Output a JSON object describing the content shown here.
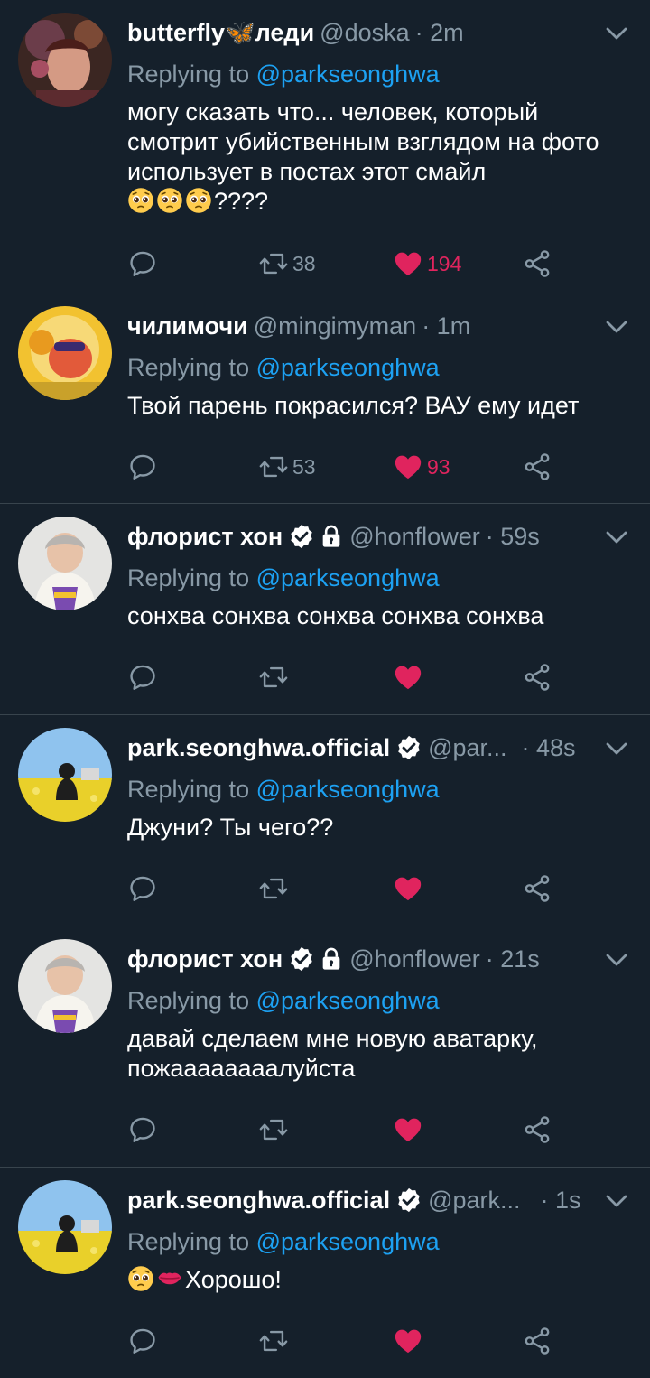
{
  "tweets": [
    {
      "name": "butterfly🦋леди",
      "handle": "@doska",
      "time": "· 2m",
      "reply_prefix": "Replying to ",
      "reply_to": "@parkseonghwa",
      "text_lines": [
        "могу сказать что... человек, который",
        "смотрит убийственным взглядом на фото",
        "использует в постах этот смайл"
      ],
      "text_tail": "????",
      "retweets": "38",
      "likes": "194"
    },
    {
      "name": "чилимочи",
      "handle": "@mingimyman",
      "time": "· 1m",
      "reply_prefix": "Replying to ",
      "reply_to": "@parkseonghwa",
      "text": "Твой парень покрасился? ВАУ ему идет",
      "retweets": "53",
      "likes": "93"
    },
    {
      "name": "флорист хон",
      "handle": "@honflower",
      "time": "· 59s",
      "reply_prefix": "Replying to ",
      "reply_to": "@parkseonghwa",
      "text": "сонхва сонхва сонхва сонхва сонхва"
    },
    {
      "name": "park.seonghwa.official",
      "handle": "@par...",
      "time": "· 48s",
      "reply_prefix": "Replying to ",
      "reply_to": "@parkseonghwa",
      "text": "Джуни? Ты чего??"
    },
    {
      "name": "флорист хон",
      "handle": "@honflower",
      "time": "· 21s",
      "reply_prefix": "Replying to ",
      "reply_to": "@parkseonghwa",
      "text_lines": [
        "давай сделаем мне новую  аватарку,",
        "пожаааааааалуйста"
      ]
    },
    {
      "name": "park.seonghwa.official",
      "handle": "@park...",
      "time": "· 1s",
      "reply_prefix": "Replying to ",
      "reply_to": "@parkseonghwa",
      "text": "Хорошо!"
    }
  ],
  "colors": {
    "background": "#15202b",
    "muted": "#8899a6",
    "accent": "#1da1f2",
    "like": "#e0245e",
    "divider": "#38444d"
  },
  "icons": [
    "reply-icon",
    "retweet-icon",
    "heart-icon",
    "share-icon",
    "verified-icon",
    "lock-icon",
    "chevron-down-icon",
    "pleading-face-emoji",
    "kiss-mark-emoji"
  ]
}
